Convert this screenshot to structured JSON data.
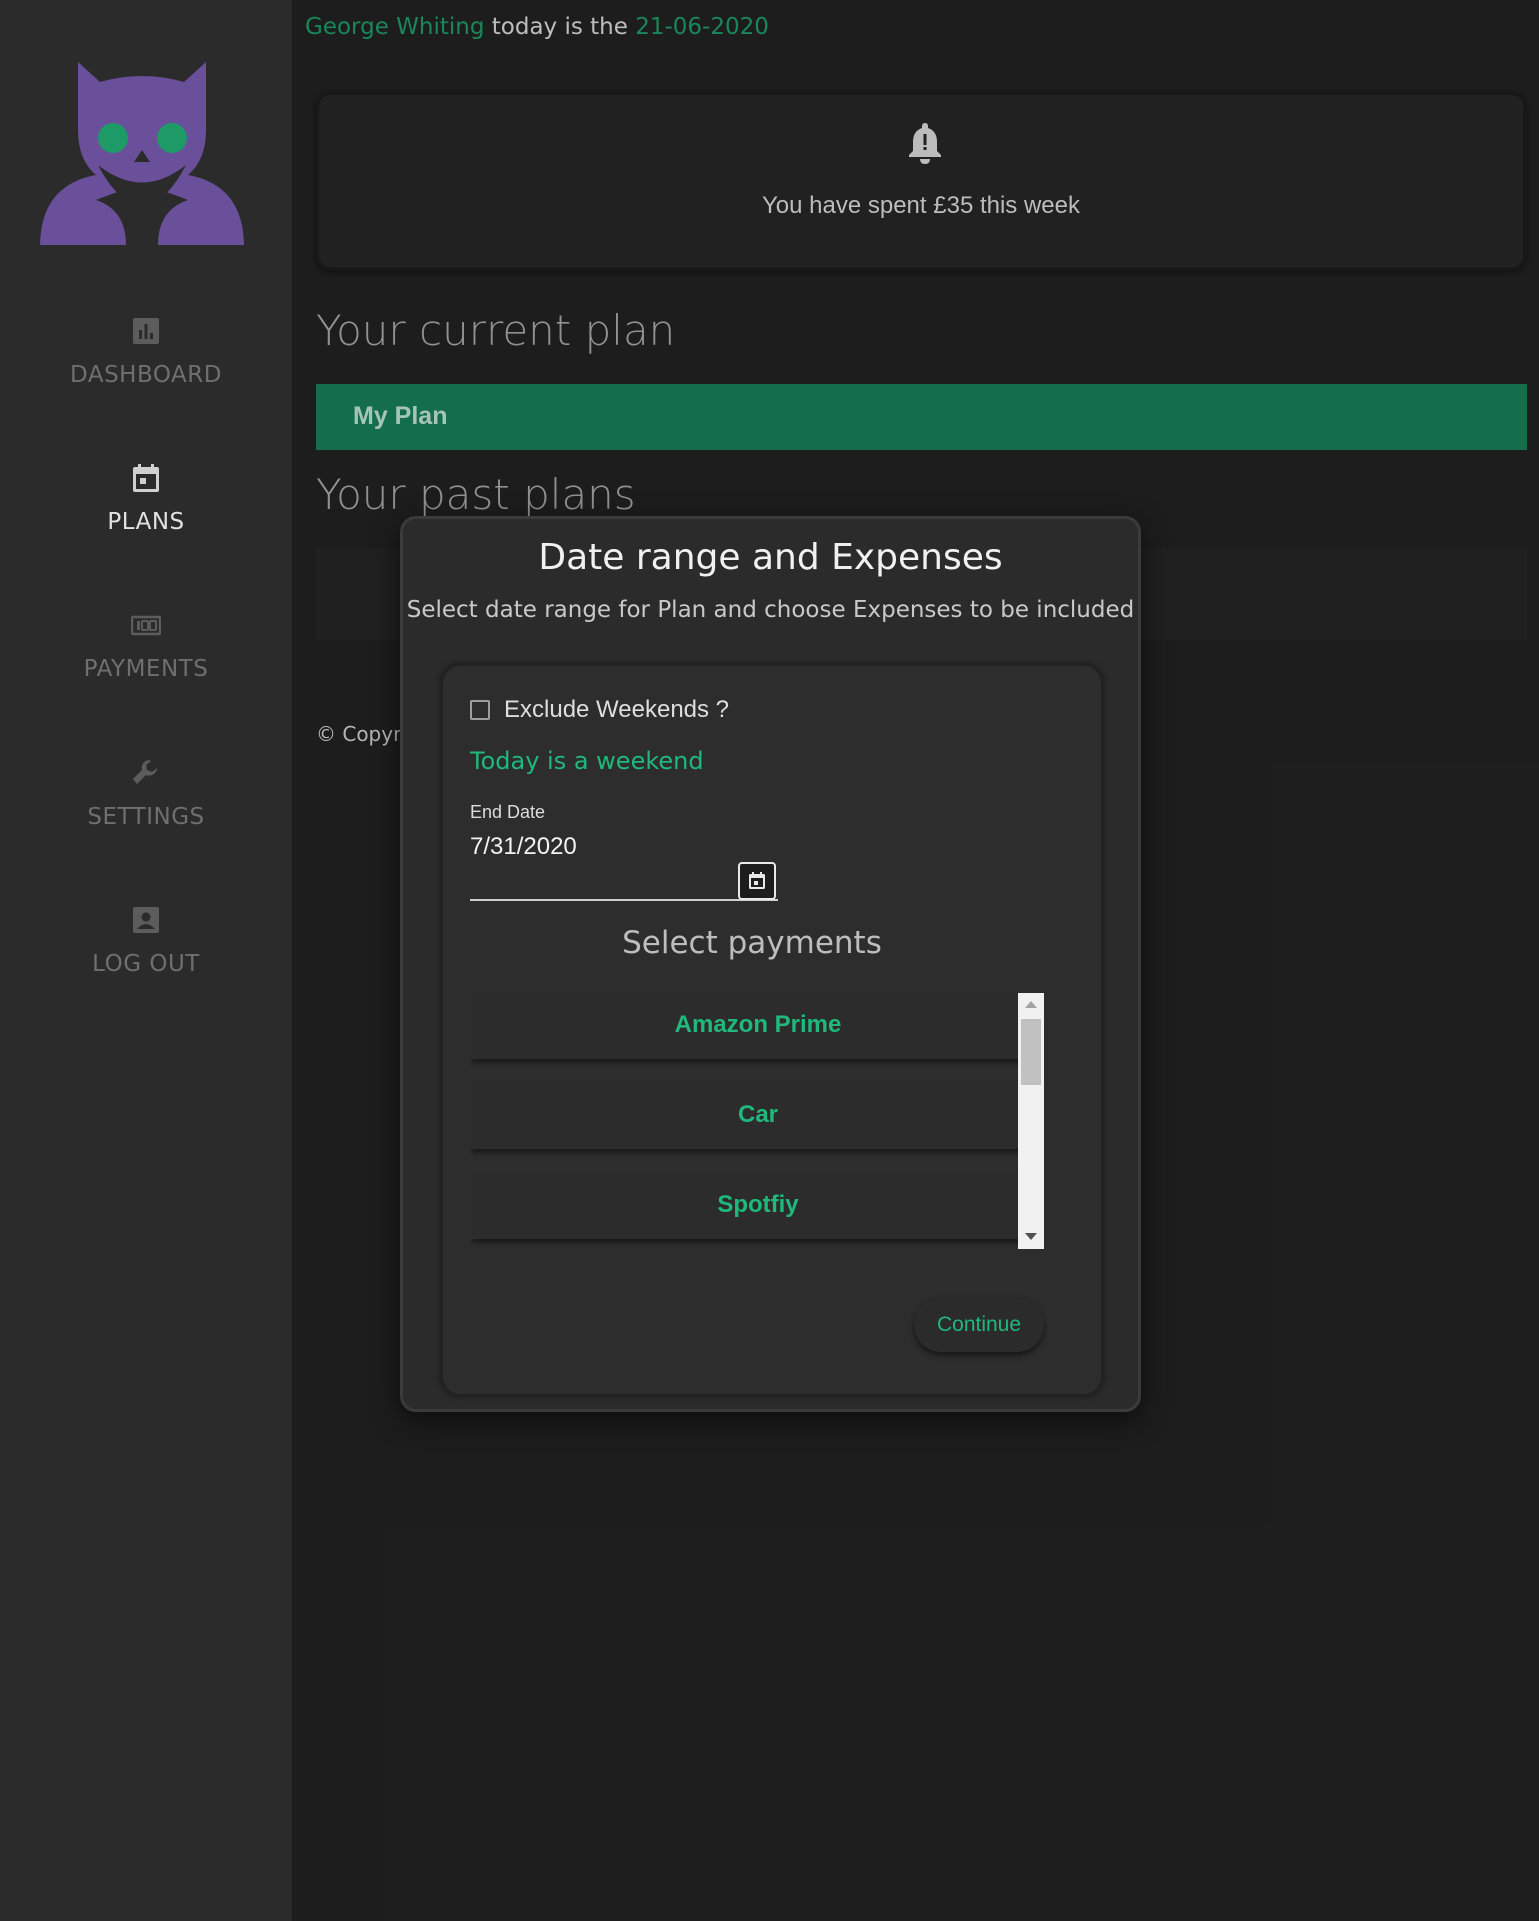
{
  "header": {
    "user_name": "George Whiting",
    "date_prefix": " today is the ",
    "date": "21-06-2020"
  },
  "sidebar": {
    "items": [
      {
        "label": "DASHBOARD",
        "icon": "bar-chart-icon"
      },
      {
        "label": "PLANS",
        "icon": "calendar-icon",
        "active": true
      },
      {
        "label": "PAYMENTS",
        "icon": "payments-icon"
      },
      {
        "label": "SETTINGS",
        "icon": "wrench-icon"
      },
      {
        "label": "LOG OUT",
        "icon": "account-box-icon"
      }
    ]
  },
  "notification": {
    "icon": "bell-icon",
    "message": "You have spent £35 this week"
  },
  "main": {
    "current_plan_title": "Your current plan",
    "current_plan_name": "My Plan",
    "past_plans_title": "Your past plans",
    "copyright": "© Copyrig"
  },
  "modal": {
    "title": "Date range and Expenses",
    "subtitle": "Select date range for Plan and choose Expenses to be included",
    "exclude_weekends_label": "Exclude Weekends ?",
    "exclude_weekends_checked": false,
    "weekend_notice": "Today is a weekend",
    "end_date_label": "End Date",
    "end_date_value": "7/31/2020",
    "select_payments_title": "Select payments",
    "payments": [
      "Amazon Prime",
      "Car",
      "Spotfiy"
    ],
    "continue_label": "Continue"
  },
  "colors": {
    "accent": "#1e9a66",
    "accent_bright": "#1fb97c",
    "plan_bar": "#177e56",
    "logo": "#6a4f9a",
    "background": "#222222",
    "sidebar": "#2b2b2b"
  }
}
